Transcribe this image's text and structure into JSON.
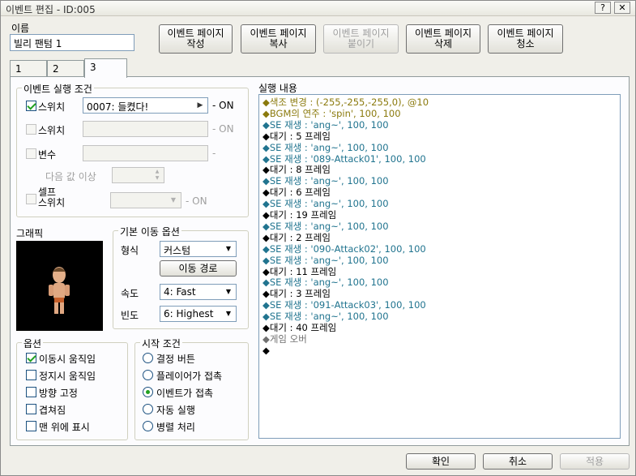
{
  "window": {
    "title": "이벤트 편집 - ID:005",
    "help_label": "?",
    "close_label": "✕"
  },
  "name_label": "이름",
  "name_value": "빌리 팬텀 1",
  "toolbar": {
    "create": "이벤트 페이지\n작성",
    "copy": "이벤트 페이지\n복사",
    "paste": "이벤트 페이지\n붙이기",
    "delete": "이벤트 페이지\n삭제",
    "clear": "이벤트 페이지\n청소"
  },
  "tabs": [
    "1",
    "2",
    "3"
  ],
  "active_tab": "3",
  "conditions": {
    "title": "이벤트 실행 조건",
    "switch1": {
      "label": "스위치",
      "value": "0007: 들켰다!",
      "suffix": "- ON",
      "checked": true
    },
    "switch2": {
      "label": "스위치",
      "value": "",
      "suffix": "- ON",
      "checked": false
    },
    "variable": {
      "label": "변수",
      "value": "",
      "suffix": "-",
      "checked": false
    },
    "threshold_label": "다음 값 이상",
    "self_switch": {
      "label": "셀프\n스위치",
      "suffix": "- ON",
      "checked": false
    }
  },
  "graphic_label": "그래픽",
  "movement": {
    "title": "기본 이동 옵션",
    "type_label": "형식",
    "type_value": "커스텀",
    "route_button": "이동 경로",
    "speed_label": "속도",
    "speed_value": "4: Fast",
    "freq_label": "빈도",
    "freq_value": "6: Highest"
  },
  "options": {
    "title": "옵션",
    "items": [
      {
        "label": "이동시 움직임",
        "checked": true
      },
      {
        "label": "정지시 움직임",
        "checked": false
      },
      {
        "label": "방향 고정",
        "checked": false
      },
      {
        "label": "겹쳐짐",
        "checked": false
      },
      {
        "label": "맨 위에 표시",
        "checked": false
      }
    ]
  },
  "trigger": {
    "title": "시작 조건",
    "items": [
      {
        "label": "결정 버튼",
        "selected": false
      },
      {
        "label": "플레이어가 접촉",
        "selected": false
      },
      {
        "label": "이벤트가 접촉",
        "selected": true
      },
      {
        "label": "자동 실행",
        "selected": false
      },
      {
        "label": "병렬 처리",
        "selected": false
      }
    ]
  },
  "commands": {
    "title": "실행 내용",
    "lines": [
      {
        "text": "◆색조 변경 : (-255,-255,-255,0), @10",
        "color": "olive"
      },
      {
        "text": "◆BGM의 연주 : 'spin', 100, 100",
        "color": "olive"
      },
      {
        "text": "◆SE 재생 : 'ang~', 100, 100",
        "color": "teal"
      },
      {
        "text": "◆대기 : 5 프레임",
        "color": "dark"
      },
      {
        "text": "◆SE 재생 : 'ang~', 100, 100",
        "color": "teal"
      },
      {
        "text": "◆SE 재생 : '089-Attack01', 100, 100",
        "color": "teal"
      },
      {
        "text": "◆대기 : 8 프레임",
        "color": "dark"
      },
      {
        "text": "◆SE 재생 : 'ang~', 100, 100",
        "color": "teal"
      },
      {
        "text": "◆대기 : 6 프레임",
        "color": "dark"
      },
      {
        "text": "◆SE 재생 : 'ang~', 100, 100",
        "color": "teal"
      },
      {
        "text": "◆대기 : 19 프레임",
        "color": "dark"
      },
      {
        "text": "◆SE 재생 : 'ang~', 100, 100",
        "color": "teal"
      },
      {
        "text": "◆대기 : 2 프레임",
        "color": "dark"
      },
      {
        "text": "◆SE 재생 : '090-Attack02', 100, 100",
        "color": "teal"
      },
      {
        "text": "◆SE 재생 : 'ang~', 100, 100",
        "color": "teal"
      },
      {
        "text": "◆대기 : 11 프레임",
        "color": "dark"
      },
      {
        "text": "◆SE 재생 : 'ang~', 100, 100",
        "color": "teal"
      },
      {
        "text": "◆대기 : 3 프레임",
        "color": "dark"
      },
      {
        "text": "◆SE 재생 : '091-Attack03', 100, 100",
        "color": "teal"
      },
      {
        "text": "◆SE 재생 : 'ang~', 100, 100",
        "color": "teal"
      },
      {
        "text": "◆대기 : 40 프레임",
        "color": "dark"
      },
      {
        "text": "◆게임 오버",
        "color": "gray"
      },
      {
        "text": "◆",
        "color": "dark"
      }
    ]
  },
  "footer": {
    "ok": "확인",
    "cancel": "취소",
    "apply": "적용"
  },
  "colors": {
    "teal": "#21748f",
    "olive": "#8b7a0d",
    "gray": "#707070",
    "dark": "#000000"
  }
}
